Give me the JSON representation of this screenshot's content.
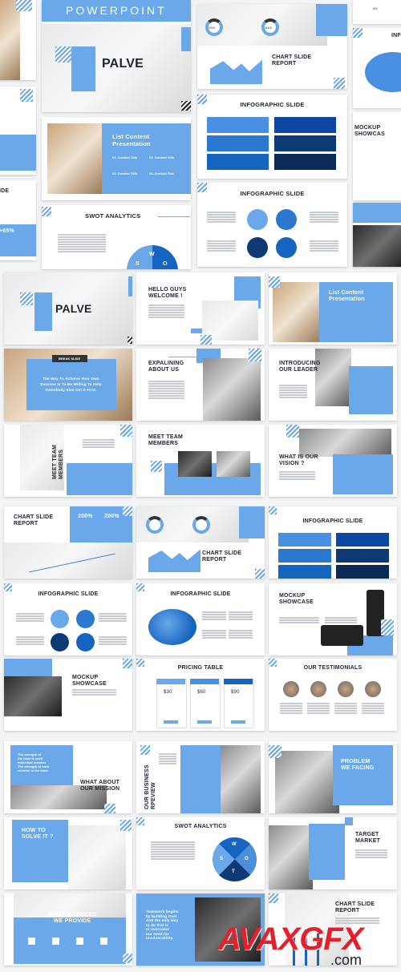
{
  "colors": {
    "accent": "#6aa8ea",
    "dark_blue": "#1565c0",
    "navy": "#0d3a75",
    "text": "#1f2430",
    "watermark_red": "#e5202a"
  },
  "collage": {
    "banner": "POWERPOINT",
    "palve": "PALVE",
    "list_title": "List Content\nPresentation",
    "list_items": [
      "01. Content Title",
      "02. Content Title",
      "03. Content Title",
      "04. Content Title"
    ],
    "chart_title": "CHART SLIDE\nREPORT",
    "donuts": [
      "75%",
      "64%"
    ],
    "infographic_1": "INFOGRAPHIC SLIDE",
    "infographic_2": "INFOGRAPHIC SLIDE",
    "swot": "SWOT ANALYTICS",
    "swot_letters": [
      "W",
      "S",
      "O"
    ],
    "left_partial_title": "IDE",
    "left_partial_value": "+65%",
    "right_partial_title": "INF",
    "right_partial_mockup": "MOCKUP\nSHOWCAS",
    "right_partial_page": "5/5"
  },
  "slides": [
    {
      "title": "PALVE"
    },
    {
      "title": "HELLO GUYS\nWELCOME !"
    },
    {
      "title": "List Content\nPresentation"
    },
    {
      "title": "The Way To Achieve Your Own\nSuccess Is To Be Willing To Help\nSomebody Else Get It First.",
      "label": "BREAK SLIDE"
    },
    {
      "title": "EXPALINING\nABOUT US"
    },
    {
      "title": "INTRODUCING\nOUR LEADER"
    },
    {
      "title": "MEET TEAM\nMEMBERS"
    },
    {
      "title": "MEET TEAM\nMEMBERS"
    },
    {
      "title": "WHAT IS OUR\nVISION ?"
    },
    {
      "title": "CHART SLIDE\nREPORT",
      "values": [
        "200%",
        "200%"
      ]
    },
    {
      "title": "CHART SLIDE\nREPORT"
    },
    {
      "title": "INFOGRAPHIC SLIDE"
    },
    {
      "title": "INFOGRAPHIC SLIDE"
    },
    {
      "title": "INFOGRAPHIC SLIDE"
    },
    {
      "title": "MOCKUP\nSHOWCASE"
    },
    {
      "title": "MOCKUP\nSHOWCASE"
    },
    {
      "title": "PRICING TABLE",
      "prices": [
        "$30",
        "$60",
        "$90"
      ]
    },
    {
      "title": "OUR TESTIMONIALS"
    },
    {
      "title": "WHAT ABOUT\nOUR MISSION",
      "quote": "The strength of\nthe team is each\nindividual member.\nThe strength of each\nmember is the team."
    },
    {
      "title": "OUR BUSINESS\nRPEVIEW"
    },
    {
      "title": "PROBLEM\nWE FACING"
    },
    {
      "title": "HOW TO\nSOLVE IT ?"
    },
    {
      "title": "SWOT ANALYTICS",
      "letters": [
        "W",
        "S",
        "O",
        "T"
      ]
    },
    {
      "title": "TARGET\nMARKET"
    },
    {
      "title": "WHAT SERVICES\nWE PROVIDE"
    },
    {
      "title": "Teamwork begins\nby building trust.\nAnd the only way\nto do that is\nto overcome\nour need for\ninvulnerability."
    },
    {
      "title": "CHART SLIDE\nREPORT"
    }
  ],
  "watermark": {
    "brand": "AVAXGFX",
    "suffix": ".com"
  }
}
